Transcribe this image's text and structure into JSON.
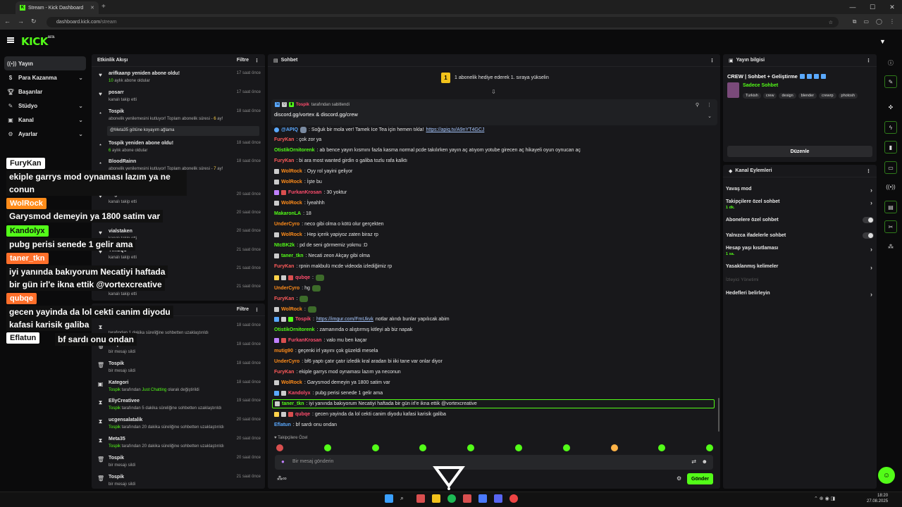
{
  "browser": {
    "tab_title": "Stream - Kick Dashboard",
    "url_host": "dashboard.kick.com",
    "url_path": "/stream"
  },
  "app": {
    "logo": "KICK",
    "logo_badge": "BETA"
  },
  "leftnav": {
    "items": [
      {
        "label": "Yayın",
        "icon": "broadcast-icon"
      },
      {
        "label": "Para Kazanma",
        "icon": "money-icon"
      },
      {
        "label": "Başarılar",
        "icon": "trophy-icon"
      },
      {
        "label": "Stüdyo",
        "icon": "studio-icon"
      },
      {
        "label": "Kanal",
        "icon": "channel-icon"
      },
      {
        "label": "Ayarlar",
        "icon": "settings-icon"
      }
    ]
  },
  "overlay": [
    {
      "name": "FuryKan",
      "name_bg": "#ffffff",
      "name_color": "#111111",
      "message": "ekiple garrys mod oynaması lazım ya ne conun"
    },
    {
      "name": "WolRock",
      "name_bg": "#ff8c1a",
      "name_color": "#ffffff",
      "message": "Garysmod demeyin ya 1800 satim var"
    },
    {
      "name": "Kandolyx",
      "name_bg": "#53fc18",
      "name_color": "#111111",
      "message": "pubg perisi senede 1 gelir ama"
    },
    {
      "name": "taner_tkn",
      "name_bg": "#ff6f2a",
      "name_color": "#ffffff",
      "message_l1": "iyi yanında bakıyorum Necatiyi haftada",
      "message_l2": "bir gün irl'e ikna ettik @vortexcreative"
    },
    {
      "name": "qubqe",
      "name_bg": "#ff6f2a",
      "name_color": "#ffffff",
      "message_l1": "gecen yayinda da lol cekti canim diyodu",
      "message_l2": "kafasi karisik galiba"
    },
    {
      "name": "Eflatun",
      "name_bg": "#ffffff",
      "name_color": "#111111",
      "message": "bf sardı onu ondan"
    }
  ],
  "activity": {
    "title": "Etkinlik Akışı",
    "filter_label": "Filtre",
    "events": [
      {
        "title": "arifkaanp yeniden abone oldu!",
        "sub_num": "10",
        "sub_text": " aylık abone oldular",
        "time": "17 saat önce",
        "icon": "heart-icon"
      },
      {
        "title": "posarr",
        "sub_text": "kanalı takip etti",
        "time": "17 saat önce",
        "icon": "heart-icon"
      },
      {
        "title": "Tospik",
        "sub_text": "abonelik yenilemesini kutluyor! Toplam abonelik süresi - ",
        "sub_num": "6",
        "sub_tail": " ay!",
        "quote": "@Meta35 götüne koyayım ağlama",
        "time": "18 saat önce",
        "icon": "star-icon"
      },
      {
        "title": "Tospik yeniden abone oldu!",
        "sub_num": "6",
        "sub_text": " aylık abone oldular",
        "time": "18 saat önce",
        "icon": "star-icon"
      },
      {
        "title": "BloodRainn",
        "sub_text": "abonelik yenilemesini kutluyor! Toplam abonelik süresi - ",
        "sub_num": "7",
        "sub_tail": " ay!",
        "time": "18 saat önce",
        "icon": "star-icon"
      },
      {
        "title": "ucgensalatalik",
        "sub_text": "kanalı takip etti",
        "time": "20 saat önce",
        "icon": "heart-icon"
      },
      {
        "title": "yeniden abone oldu!",
        "sub_text": "aylık abone oldular",
        "time": "20 saat önce",
        "icon": "star-icon"
      },
      {
        "title": "vialstaken",
        "sub_text": "kanalı takip etti",
        "time": "20 saat önce",
        "icon": "heart-icon"
      },
      {
        "title": "YlmzQ3",
        "sub_text": "kanalı takip etti",
        "time": "21 saat önce",
        "icon": "heart-icon"
      },
      {
        "title": "",
        "sub_text": "",
        "time": "21 saat önce",
        "icon": "heart-icon"
      },
      {
        "title": "byjibrayt",
        "sub_text": "kanalı takip etti",
        "time": "21 saat önce",
        "icon": "heart-icon"
      }
    ]
  },
  "modlog": {
    "filter_label": "Filtre",
    "events": [
      {
        "title": "",
        "sub_text": "tarafından 1 dakika süreliğine sohbetten uzaklaştırıldı",
        "time": "18 saat önce",
        "icon": "hourglass-icon"
      },
      {
        "title": "Tospik",
        "sub_text": "bir mesajı sildi",
        "time": "18 saat önce",
        "icon": "trash-icon"
      },
      {
        "title": "Tospik",
        "sub_text": "bir mesajı sildi",
        "time": "18 saat önce",
        "icon": "trash-icon"
      },
      {
        "title": "Kategori",
        "sub_user": "Tospik",
        "sub_text": " tarafından ",
        "sub_hl": "Just Chatting",
        "sub_tail": " olarak değiştirildi",
        "time": "18 saat önce",
        "icon": "category-icon"
      },
      {
        "title": "EllyCreativee",
        "sub_user": "Tospik",
        "sub_text": " tarafından 5 dakika süreliğine sohbetten uzaklaştırıldı",
        "time": "19 saat önce",
        "icon": "hourglass-icon"
      },
      {
        "title": "ucgensalatalik",
        "sub_user": "Tospik",
        "sub_text": " tarafından 20 dakika süreliğine sohbetten uzaklaştırıldı",
        "time": "20 saat önce",
        "icon": "hourglass-icon"
      },
      {
        "title": "Meta35",
        "sub_user": "Tospik",
        "sub_text": " tarafından 20 dakika süreliğine sohbetten uzaklaştırıldı",
        "time": "20 saat önce",
        "icon": "hourglass-icon"
      },
      {
        "title": "Tospik",
        "sub_text": "bir mesajı sildi",
        "time": "20 saat önce",
        "icon": "trash-icon"
      },
      {
        "title": "Tospik",
        "sub_text": "bir mesajı sildi",
        "time": "21 saat önce",
        "icon": "trash-icon"
      }
    ]
  },
  "chat": {
    "title": "Sohbet",
    "gift_goal": "1 abonelik hediye ederek 1. sıraya yükselin",
    "pinned_by_user": "Tospik",
    "pinned_by_text": " tarafından sabitlendi",
    "pinned_message": "discord.gg/vortex & discord.gg/crew",
    "messages": [
      {
        "user": "@APIQ",
        "color": "#5aa9ff",
        "text": ": Soğuk bir mola ver! Tamek Ice Tea için hemen tıkla! ",
        "link": "https://apiq.tv/A9nYT4GCJ"
      },
      {
        "user": "FuryKan",
        "color": "#ff5a5a",
        "text": ": çok zor ya"
      },
      {
        "user": "OtistikOrnitorenk",
        "color": "#53fc18",
        "text": ": ab bence yayın kısmını fazla kasma normal pcde takılırken yayın aç atıyom yotube girecen aç hikayeli oyun oynucan aç"
      },
      {
        "user": "FuryKan",
        "color": "#ff5a5a",
        "text": ": bi ara most wanted girdin o galiba tozlu rafa kalktı"
      },
      {
        "user": "WolRock",
        "color": "#ff8c1a",
        "text": ": Oyy rol yayini geliyor"
      },
      {
        "user": "WolRock",
        "color": "#ff8c1a",
        "text": ": İşte bu"
      },
      {
        "user": "FurkanKrosan",
        "color": "#ff4d6d",
        "text": ": 30 yoktur"
      },
      {
        "user": "WolRock",
        "color": "#ff8c1a",
        "text": ": İyeahhh"
      },
      {
        "user": "MakaronLA",
        "color": "#53fc18",
        "text": ": 18"
      },
      {
        "user": "UnderCyro",
        "color": "#ff8c1a",
        "text": ": neco gibi olma o kötü olur gerçekten"
      },
      {
        "user": "WolRock",
        "color": "#ff8c1a",
        "text": ": Hep içerik yapiyoz zaten biraz rp"
      },
      {
        "user": "NtcBK2k",
        "color": "#53fc18",
        "text": ": pd de seni görmemiz yokmu :D"
      },
      {
        "user": "taner_tkn",
        "color": "#53fc18",
        "text": ": Necati zeon Akçay gibi olma"
      },
      {
        "user": "FuryKan",
        "color": "#ff5a5a",
        "text": ": rpnin makbulü mcde videoda izlediğimiz rp"
      },
      {
        "user": "qubqe",
        "color": "#ff4d6d",
        "text": ":"
      },
      {
        "user": "UnderCyro",
        "color": "#ff8c1a",
        "text": ": hg"
      },
      {
        "user": "FuryKan",
        "color": "#ff5a5a",
        "text": ":"
      },
      {
        "user": "WolRock",
        "color": "#ff8c1a",
        "text": ":"
      },
      {
        "user": "Tospik",
        "color": "#ff4d6d",
        "text": ": ",
        "link": "https://imgur.com/FmUkvk",
        "tail": " notlar alındı bunlar yapılıcak abim"
      },
      {
        "user": "OtistikOrnitorenk",
        "color": "#53fc18",
        "text": ": zamanında o alıştırmış kitleyi ab biz napak"
      },
      {
        "user": "FurkanKrosan",
        "color": "#ff4d6d",
        "text": ": valo mu ben kaçar"
      },
      {
        "user": "mutig90",
        "color": "#ff8c1a",
        "text": ": geçenki irl yayını çok güzeldi mesela"
      },
      {
        "user": "UnderCyro",
        "color": "#ff8c1a",
        "text": ": bf6 yaptı çatır çatır izledik kral aradan bi iiki tane var onlar diyor"
      },
      {
        "user": "FuryKan",
        "color": "#ff5a5a",
        "text": ": ekiple garrys mod oynaması lazım ya neconun"
      },
      {
        "user": "WolRock",
        "color": "#ff8c1a",
        "text": ": Garysmod demeyin ya 1800 satim var"
      },
      {
        "user": "Kandolyx",
        "color": "#ff4d6d",
        "text": ": pubg perisi senede 1 gelir ama"
      },
      {
        "user": "taner_tkn",
        "color": "#53fc18",
        "text": ": iyi yanında bakıyorum Necatiyi haftada bir gün irl'e ikna ettik @vortexcreative"
      },
      {
        "user": "qubqe",
        "color": "#ff4d6d",
        "text": ": gecen yayinda da lol cekti canim diyodu kafasi karisik galiba"
      },
      {
        "user": "Eflatun",
        "color": "#5aa9ff",
        "text": ": bf sardı onu ondan"
      }
    ],
    "followers_only_label": "Takipçilere Özel",
    "input_placeholder": "Bir mesaj gönderin",
    "send_label": "Gönder"
  },
  "streaminfo": {
    "title": "Yayın bilgisi",
    "stream_title": "CREW | Sohbet + Geliştirme",
    "category": "Sadece Sohbet",
    "tags": [
      "Turkish",
      "crew",
      "design",
      "blender",
      "crewrp",
      "photosh"
    ],
    "edit_label": "Düzenle"
  },
  "channelactions": {
    "title": "Kanal Eylemleri",
    "slow_mode": "Yavaş mod",
    "followers_only": "Takipçilere özel sohbet",
    "followers_only_val": "1 dk.",
    "subs_only": "Abonelere özel sohbet",
    "emotes_only": "Yalnızca ifadelerle sohbet",
    "account_age": "Hesap yaşı kısıtlaması",
    "account_age_val": "1 sa.",
    "banned_words": "Yasaklanmış kelimeler",
    "viewer_mgmt": "İzleyici Yönetimi",
    "goals": "Hedefleri belirleyin"
  },
  "clock": {
    "time": "18:20",
    "date": "27.08.2025"
  },
  "colors": {
    "accent": "#53fc18",
    "panel": "#18181b",
    "bg": "#0b0b0c"
  }
}
